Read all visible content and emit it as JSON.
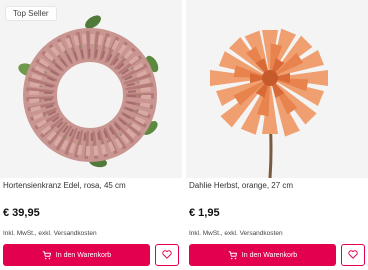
{
  "colors": {
    "accent": "#e2004f",
    "image_bg": "#f4f4f4"
  },
  "products": [
    {
      "badge": "Top Seller",
      "image": "hydrangea-wreath-image",
      "name": "Hortensienkranz Edel, rosa, 45 cm",
      "price": "€ 39,95",
      "tax_note": "Inkl. MwSt., exkl. Versandkosten",
      "cart_label": "In den Warenkorb",
      "cart_icon": "cart-icon",
      "wishlist_icon": "heart-icon"
    },
    {
      "image": "dahlia-image",
      "name": "Dahlie Herbst, orange, 27 cm",
      "price": "€ 1,95",
      "tax_note": "Inkl. MwSt., exkl. Versandkosten",
      "cart_label": "In den Warenkorb",
      "cart_icon": "cart-icon",
      "wishlist_icon": "heart-icon"
    }
  ]
}
